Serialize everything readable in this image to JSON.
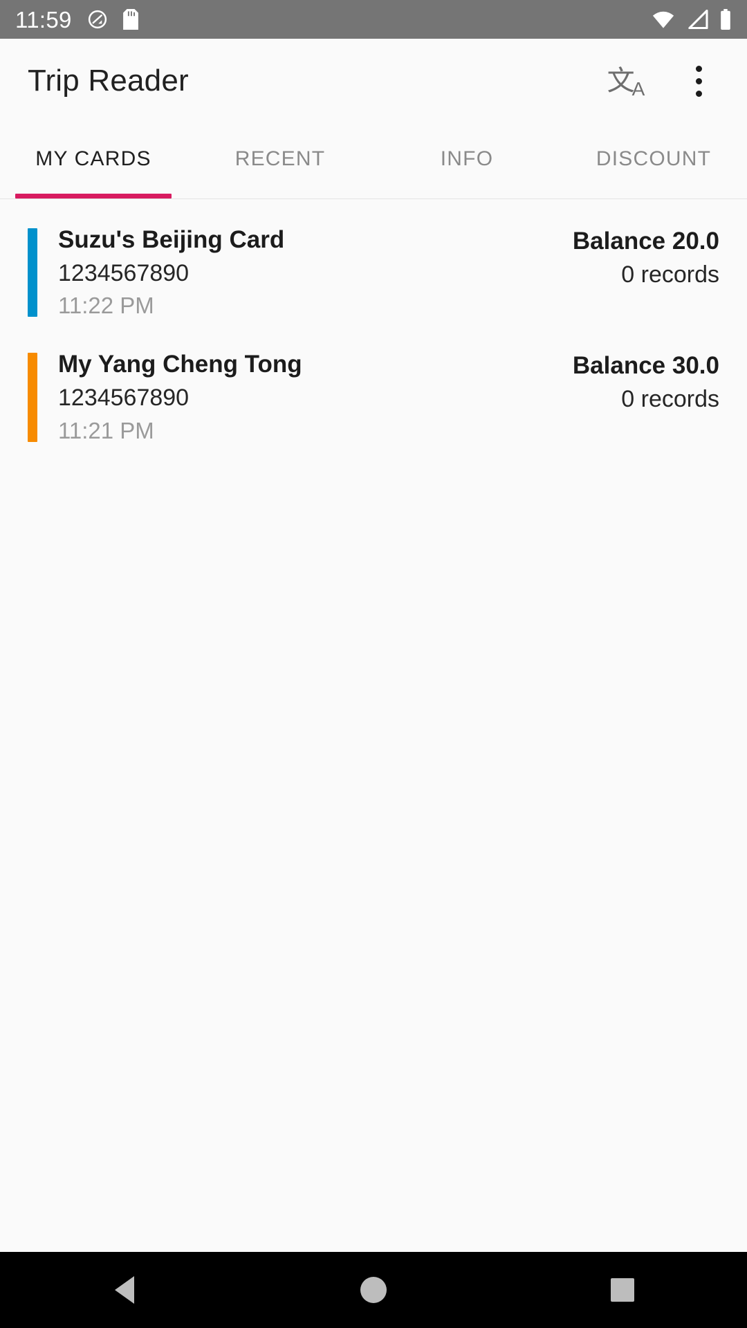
{
  "status_bar": {
    "time": "11:59",
    "left_icons": [
      "do-not-disturb-icon",
      "sd-card-icon"
    ],
    "right_icons": [
      "wifi-icon",
      "cellular-signal-icon",
      "battery-icon"
    ],
    "background": "#757575",
    "foreground": "#ffffff"
  },
  "app_bar": {
    "title": "Trip Reader",
    "translate_glyph": "文",
    "translate_sub": "A",
    "actions": [
      "translate-icon",
      "overflow-menu-icon"
    ]
  },
  "tabs": {
    "active_index": 0,
    "indicator_color": "#d81b60",
    "items": [
      {
        "label": "MY CARDS"
      },
      {
        "label": "RECENT"
      },
      {
        "label": "INFO"
      },
      {
        "label": "DISCOUNT"
      }
    ]
  },
  "cards": [
    {
      "name": "Suzu's Beijing Card",
      "number": "1234567890",
      "time": "11:22 PM",
      "balance": "Balance 20.0",
      "records": "0 records",
      "accent_color": "#0091cc"
    },
    {
      "name": "My Yang Cheng Tong",
      "number": "1234567890",
      "time": "11:21 PM",
      "balance": "Balance 30.0",
      "records": "0 records",
      "accent_color": "#f78b00"
    }
  ],
  "nav_bar": {
    "background": "#000000",
    "buttons": [
      "back-button",
      "home-button",
      "recents-button"
    ]
  }
}
